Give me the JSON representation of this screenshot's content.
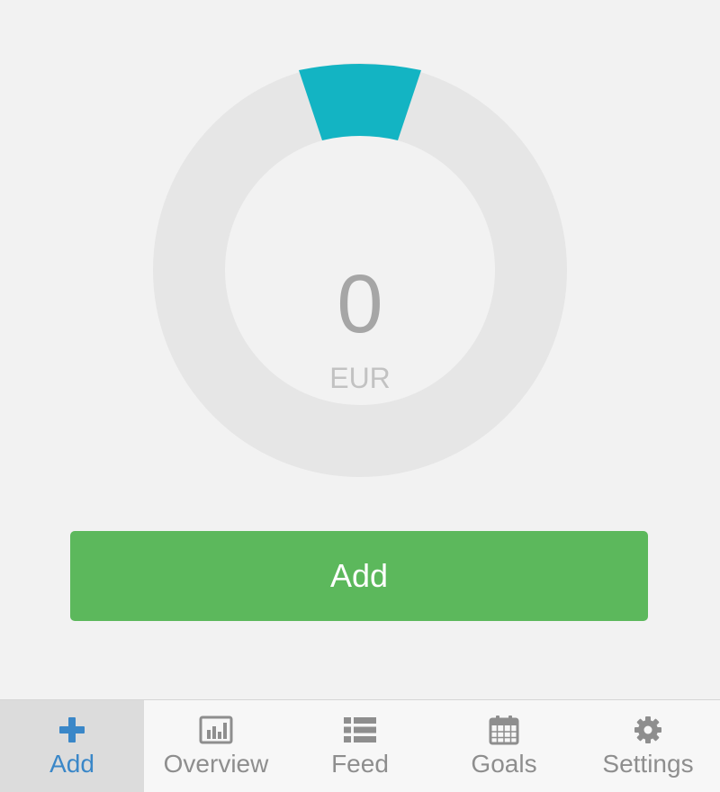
{
  "dial": {
    "amount": "0",
    "currency": "EUR",
    "colors": {
      "track": "#e6e6e6",
      "marker": "#13b4c3"
    }
  },
  "primary_action": {
    "label": "Add",
    "color": "#5cb85c"
  },
  "tabbar": {
    "active": "add",
    "tabs": [
      {
        "id": "add",
        "label": "Add",
        "icon": "plus-icon"
      },
      {
        "id": "overview",
        "label": "Overview",
        "icon": "bar-chart-icon"
      },
      {
        "id": "feed",
        "label": "Feed",
        "icon": "list-icon"
      },
      {
        "id": "goals",
        "label": "Goals",
        "icon": "calendar-icon"
      },
      {
        "id": "settings",
        "label": "Settings",
        "icon": "gear-icon"
      }
    ]
  }
}
